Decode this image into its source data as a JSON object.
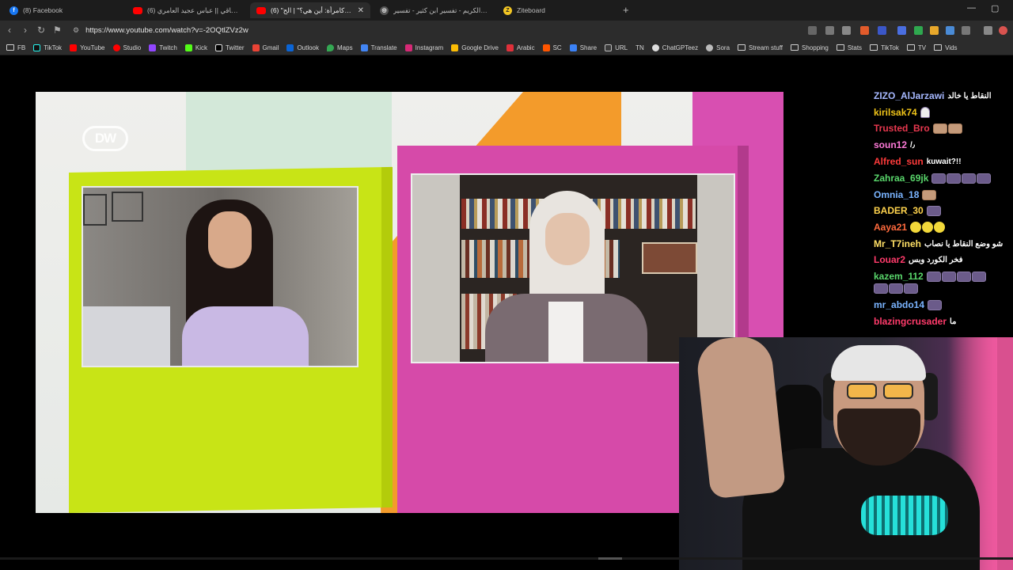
{
  "tabs": [
    {
      "title": "(8) Facebook",
      "icon": "facebook-icon",
      "active": false
    },
    {
      "title": "(6) اجمل ساقي || عباس عجيد العامري :k",
      "icon": "youtube-icon",
      "active": false
    },
    {
      "title": "(6) \"حقوقي كامرأة: أين هي؟\" | الح",
      "icon": "youtube-icon",
      "active": true
    },
    {
      "title": "القرآن الكريم - تفسير ابن كثير - تفسير",
      "icon": "globe-icon",
      "active": false
    },
    {
      "title": "Ziteboard",
      "icon": "ziteboard-icon",
      "active": false
    }
  ],
  "address": {
    "url": "https://www.youtube.com/watch?v=-2OQtlZVz2w"
  },
  "bookmarks": [
    {
      "label": "FB",
      "icon": "folder-icon"
    },
    {
      "label": "TikTok",
      "icon": "tiktok-icon"
    },
    {
      "label": "YouTube",
      "icon": "youtube-icon"
    },
    {
      "label": "Studio",
      "icon": "youtube-studio-icon"
    },
    {
      "label": "Twitch",
      "icon": "twitch-icon"
    },
    {
      "label": "Kick",
      "icon": "kick-icon"
    },
    {
      "label": "Twitter",
      "icon": "x-icon"
    },
    {
      "label": "Gmail",
      "icon": "gmail-icon"
    },
    {
      "label": "Outlook",
      "icon": "outlook-icon"
    },
    {
      "label": "Maps",
      "icon": "maps-icon"
    },
    {
      "label": "Translate",
      "icon": "translate-icon"
    },
    {
      "label": "Instagram",
      "icon": "instagram-icon"
    },
    {
      "label": "Google Drive",
      "icon": "drive-icon"
    },
    {
      "label": "Arabic",
      "icon": "arabic-icon"
    },
    {
      "label": "SC",
      "icon": "sc-icon"
    },
    {
      "label": "Share",
      "icon": "share-icon"
    },
    {
      "label": "URL",
      "icon": "url-icon"
    },
    {
      "label": "TN",
      "icon": "none"
    },
    {
      "label": "ChatGPTeez",
      "icon": "chatgpt-icon"
    },
    {
      "label": "Sora",
      "icon": "sora-icon"
    },
    {
      "label": "Stream stuff",
      "icon": "folder-icon"
    },
    {
      "label": "Shopping",
      "icon": "folder-icon"
    },
    {
      "label": "Stats",
      "icon": "folder-icon"
    },
    {
      "label": "TikTok",
      "icon": "folder-icon"
    },
    {
      "label": "TV",
      "icon": "folder-icon"
    },
    {
      "label": "Vids",
      "icon": "folder-icon"
    }
  ],
  "video": {
    "logo_text": "DW"
  },
  "chat": {
    "messages": [
      {
        "user": "ZIZO_AlJarzawi",
        "color": "#a6b8ff",
        "text": "النقاط يا خالد",
        "emotes": []
      },
      {
        "user": "kirilsak74",
        "color": "#f0c419",
        "text": "",
        "emotes": [
          "ghost"
        ]
      },
      {
        "user": "Trusted_Bro",
        "color": "#e8384f",
        "text": "",
        "emotes": [
          "face",
          "face"
        ]
      },
      {
        "user": "soun12",
        "color": "#ff7ad9",
        "text": "/٫",
        "emotes": []
      },
      {
        "user": "Alfred_sun",
        "color": "#ff3b3b",
        "text": "kuwait?!!",
        "emotes": []
      },
      {
        "user": "Zahraa_69jk",
        "color": "#59d66b",
        "text": "",
        "emotes": [
          "e",
          "e",
          "e",
          "e"
        ]
      },
      {
        "user": "Omnia_18",
        "color": "#7ab4ff",
        "text": "",
        "emotes": [
          "face"
        ]
      },
      {
        "user": "BADER_30",
        "color": "#ffd34d",
        "text": "",
        "emotes": [
          "e"
        ]
      },
      {
        "user": "Aaya21",
        "color": "#ff6a3d",
        "text": "",
        "emotes": [
          "y",
          "y",
          "y"
        ]
      },
      {
        "user": "Mr_T7ineh",
        "color": "#ffe066",
        "text": "شو وضع النقاط يا نصاب",
        "emotes": []
      },
      {
        "user": "Louar2",
        "color": "#ff3b6b",
        "text": "فخر الكورد وبس",
        "emotes": []
      },
      {
        "user": "kazem_112",
        "color": "#59d66b",
        "text": "",
        "emotes": [
          "e",
          "e",
          "e",
          "e"
        ]
      },
      {
        "user": "",
        "color": "#59d66b",
        "text": "",
        "emotes": [
          "e",
          "e",
          "e"
        ]
      },
      {
        "user": "mr_abdo14",
        "color": "#7ab4ff",
        "text": "",
        "emotes": [
          "e"
        ]
      },
      {
        "user": "blazingcrusader",
        "color": "#ff3b6b",
        "text": "ما",
        "emotes": []
      }
    ]
  }
}
